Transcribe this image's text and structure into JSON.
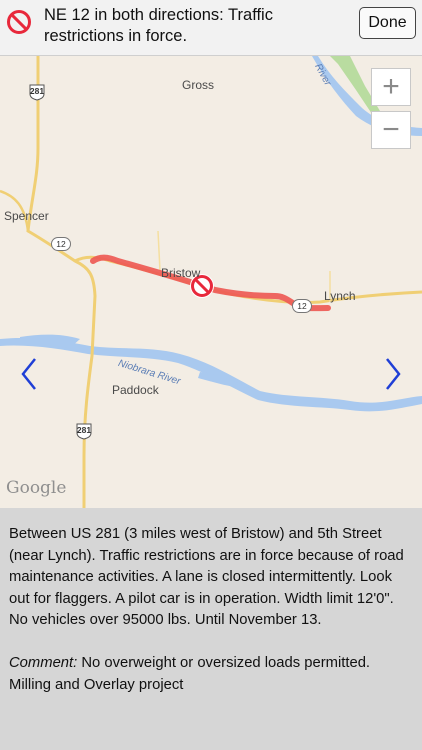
{
  "header": {
    "title": "NE 12 in both directions: Traffic restrictions in force.",
    "done_label": "Done",
    "icon": "no-entry-icon",
    "icon_color": "#e8283b"
  },
  "map": {
    "places": [
      "Gross",
      "Spencer",
      "Bristow",
      "Lynch",
      "Paddock"
    ],
    "river_labels": [
      "Niobrara River",
      "River"
    ],
    "highway_shields": [
      "281",
      "281"
    ],
    "highway_badges": [
      "12",
      "12"
    ],
    "zoom_in_label": "+",
    "zoom_out_label": "−",
    "logo_text": "Google",
    "route_color": "#ee5a55",
    "incident_icon": "no-entry-icon"
  },
  "description": {
    "body": "Between US 281 (3 miles west of Bristow) and 5th Street (near Lynch). Traffic restrictions are in force because of road maintenance activities. A lane is closed intermittently. Look out for flaggers. A pilot car is in operation. Width limit 12'0\". No vehicles over 95000 lbs. Until November 13.",
    "comment_label": "Comment:",
    "comment_text": " No overweight or oversized loads permitted. Milling and Overlay project"
  }
}
